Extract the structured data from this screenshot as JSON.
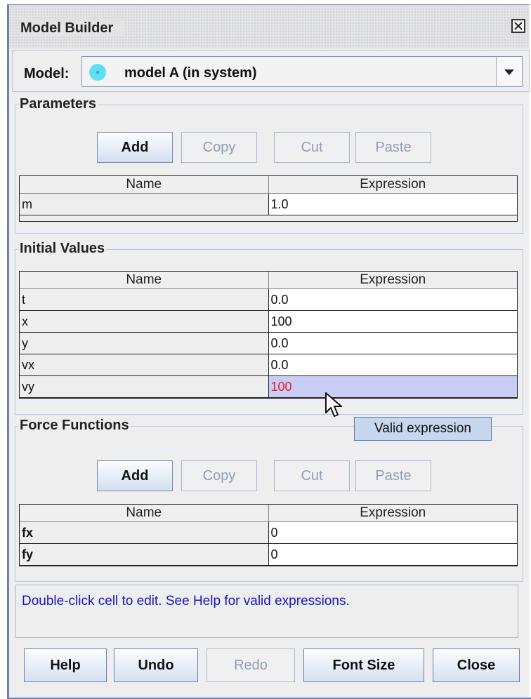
{
  "window": {
    "title": "Model Builder"
  },
  "model": {
    "label": "Model:",
    "selected": "model A (in system)"
  },
  "parameters": {
    "title": "Parameters",
    "buttons": {
      "add": "Add",
      "copy": "Copy",
      "cut": "Cut",
      "paste": "Paste"
    },
    "columns": [
      "Name",
      "Expression"
    ],
    "rows": [
      {
        "name": "m",
        "expression": "1.0"
      }
    ]
  },
  "initial_values": {
    "title": "Initial Values",
    "columns": [
      "Name",
      "Expression"
    ],
    "rows": [
      {
        "name": "t",
        "expression": "0.0"
      },
      {
        "name": "x",
        "expression": "100"
      },
      {
        "name": "y",
        "expression": "0.0"
      },
      {
        "name": "vx",
        "expression": "0.0"
      },
      {
        "name": "vy",
        "expression": "100"
      }
    ]
  },
  "tooltip": "Valid expression",
  "force_functions": {
    "title": "Force Functions",
    "buttons": {
      "add": "Add",
      "copy": "Copy",
      "cut": "Cut",
      "paste": "Paste"
    },
    "columns": [
      "Name",
      "Expression"
    ],
    "rows": [
      {
        "name": "fx",
        "expression": "0"
      },
      {
        "name": "fy",
        "expression": "0"
      }
    ]
  },
  "status": "Double-click cell to edit. See Help for valid expressions.",
  "footer": {
    "help": "Help",
    "undo": "Undo",
    "redo": "Redo",
    "font_size": "Font Size",
    "close": "Close"
  },
  "colors": {
    "accent": "#6b7fb8",
    "selected_row": "#c9ccf5",
    "invalid_text": "#e0202a",
    "status_text": "#1515c8"
  },
  "icons": {
    "close": "close-icon",
    "model": "model-dot-icon",
    "dropdown": "chevron-down-icon",
    "cursor": "mouse-pointer-icon"
  }
}
